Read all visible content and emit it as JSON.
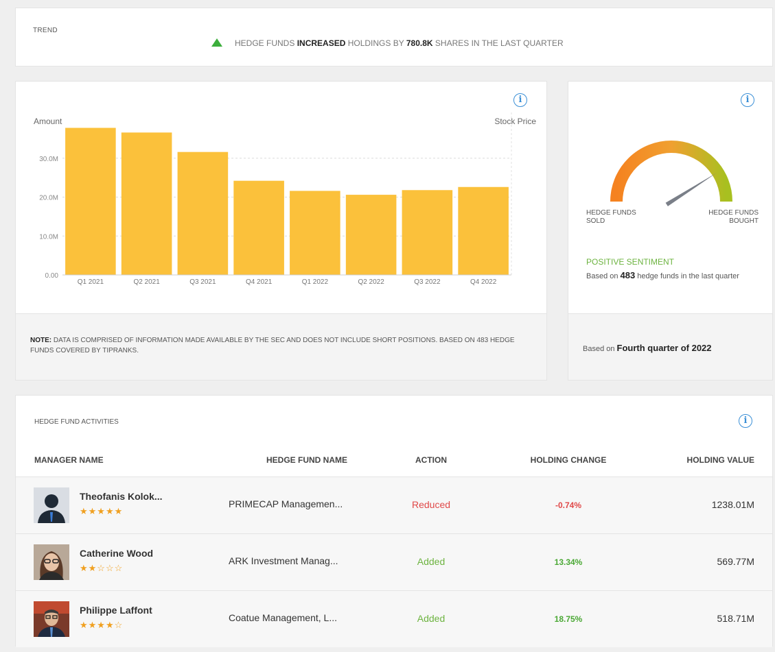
{
  "trend": {
    "label": "TREND",
    "msg_prefix": "HEDGE FUNDS ",
    "msg_action": "INCREASED",
    "msg_mid": " HOLDINGS BY ",
    "msg_amount": "780.8K",
    "msg_suffix": " SHARES IN THE LAST QUARTER",
    "direction": "up"
  },
  "chart_data": {
    "type": "bar",
    "ylabel": "Amount",
    "y2label": "Stock Price",
    "categories": [
      "Q1 2021",
      "Q2 2021",
      "Q3 2021",
      "Q4 2021",
      "Q1 2022",
      "Q2 2022",
      "Q3 2022",
      "Q4 2022"
    ],
    "values": [
      37.8,
      36.6,
      31.6,
      24.2,
      21.6,
      20.6,
      21.8,
      22.6
    ],
    "unit": "M",
    "yticks": [
      "0.00",
      "10.0M",
      "20.0M",
      "30.0M"
    ],
    "ylim": [
      0,
      40
    ],
    "grid": true,
    "bar_color": "#fbc13b"
  },
  "note": {
    "lead": "NOTE:",
    "text": " DATA IS COMPRISED OF INFORMATION MADE AVAILABLE BY THE SEC AND DOES NOT INCLUDE SHORT POSITIONS. BASED ON 483 HEDGE FUNDS COVERED BY TIPRANKS."
  },
  "sentiment": {
    "sold_label_1": "HEDGE FUNDS",
    "sold_label_2": "SOLD",
    "bought_label_1": "HEDGE FUNDS",
    "bought_label_2": "BOUGHT",
    "sentiment_label": "POSITIVE SENTIMENT",
    "based_pre": "Based on ",
    "based_count": "483",
    "based_post": " hedge funds in the last quarter",
    "foot_pre": "Based on ",
    "foot_period": "Fourth quarter of 2022",
    "gauge_level": 0.82
  },
  "activities": {
    "title": "HEDGE FUND ACTIVITIES",
    "headers": {
      "manager": "MANAGER NAME",
      "fund": "HEDGE FUND NAME",
      "action": "ACTION",
      "change": "HOLDING CHANGE",
      "value": "HOLDING VALUE"
    },
    "rows": [
      {
        "manager": "Theofanis Kolok...",
        "stars": "★★★★★",
        "fund": "PRIMECAP Managemen...",
        "action": "Reduced",
        "change": "-0.74%",
        "value": "1238.01M"
      },
      {
        "manager": "Catherine Wood",
        "stars": "★★☆☆☆",
        "fund": "ARK Investment Manag...",
        "action": "Added",
        "change": "13.34%",
        "value": "569.77M"
      },
      {
        "manager": "Philippe Laffont",
        "stars": "★★★★☆",
        "fund": "Coatue Management, L...",
        "action": "Added",
        "change": "18.75%",
        "value": "518.71M"
      }
    ]
  },
  "colors": {
    "accent": "#3a8fd6",
    "positive": "#6cb33f",
    "negative": "#e04848",
    "star": "#f0a020"
  }
}
